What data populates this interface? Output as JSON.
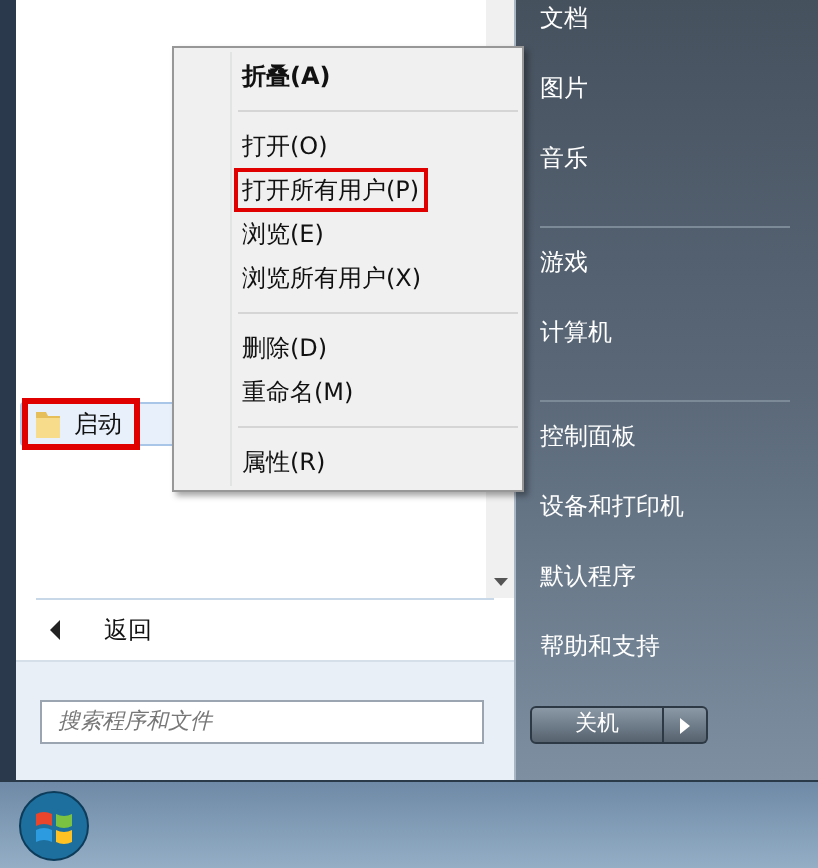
{
  "programs": {
    "items": [
      {
        "label": "启动",
        "selected": true,
        "annotated": true
      }
    ]
  },
  "back": {
    "label": "返回"
  },
  "search": {
    "placeholder": "搜索程序和文件"
  },
  "places": [
    {
      "kind": "item",
      "label": "文档"
    },
    {
      "kind": "item",
      "label": "图片"
    },
    {
      "kind": "item",
      "label": "音乐"
    },
    {
      "kind": "separator"
    },
    {
      "kind": "item",
      "label": "游戏"
    },
    {
      "kind": "item",
      "label": "计算机"
    },
    {
      "kind": "separator"
    },
    {
      "kind": "item",
      "label": "控制面板"
    },
    {
      "kind": "item",
      "label": "设备和打印机"
    },
    {
      "kind": "item",
      "label": "默认程序"
    },
    {
      "kind": "item",
      "label": "帮助和支持"
    }
  ],
  "shutdown": {
    "label": "关机"
  },
  "context_menu": {
    "items": [
      {
        "kind": "item",
        "label": "折叠(A)",
        "default": true,
        "annotated": false
      },
      {
        "kind": "separator"
      },
      {
        "kind": "item",
        "label": "打开(O)",
        "default": false,
        "annotated": false
      },
      {
        "kind": "item",
        "label": "打开所有用户(P)",
        "default": false,
        "annotated": true
      },
      {
        "kind": "item",
        "label": "浏览(E)",
        "default": false,
        "annotated": false
      },
      {
        "kind": "item",
        "label": "浏览所有用户(X)",
        "default": false,
        "annotated": false
      },
      {
        "kind": "separator"
      },
      {
        "kind": "item",
        "label": "删除(D)",
        "default": false,
        "annotated": false
      },
      {
        "kind": "item",
        "label": "重命名(M)",
        "default": false,
        "annotated": false
      },
      {
        "kind": "separator"
      },
      {
        "kind": "item",
        "label": "属性(R)",
        "default": false,
        "annotated": false
      }
    ]
  }
}
